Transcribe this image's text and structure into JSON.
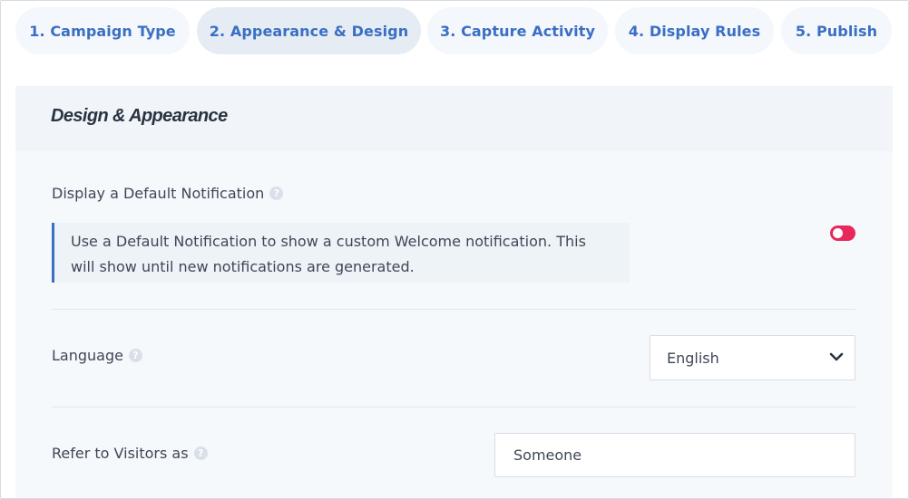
{
  "tabs": [
    {
      "label": "1. Campaign Type"
    },
    {
      "label": "2. Appearance & Design"
    },
    {
      "label": "3. Capture Activity"
    },
    {
      "label": "4. Display Rules"
    },
    {
      "label": "5. Publish"
    }
  ],
  "active_tab": "2. Appearance & Design",
  "section": {
    "title": "Design & Appearance"
  },
  "default_notification": {
    "label": "Display a Default Notification",
    "description_line1": "Use a Default Notification to show a custom Welcome notification. This",
    "description_line2": "will show until new notifications are generated.",
    "toggle_on": false,
    "toggle_color": "#e8275a"
  },
  "language": {
    "label": "Language",
    "selected": "English"
  },
  "visitors": {
    "label": "Refer to Visitors as",
    "value": "Someone"
  },
  "help_icon": "question-circle-icon",
  "colors": {
    "accent": "#3a6fc4",
    "tab_bg": "#f4f7fb",
    "tab_active_bg": "#e6ecf4",
    "panel_bg": "#f6f9fc"
  }
}
